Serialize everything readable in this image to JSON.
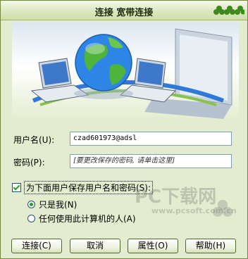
{
  "window": {
    "title": "连接 宽带连接"
  },
  "form": {
    "username_label": "用户名(U):",
    "username_value": "czad601973@adsl",
    "password_label": "密码(P):",
    "password_placeholder": "[要更改保存的密码, 请单击这里]",
    "save_checkbox_label": "为下面用户保存用户名和密码(S):",
    "save_checked": true,
    "radio_me_label": "只是我(N)",
    "radio_anyone_label": "任何使用此计算机的人(A)",
    "selected_radio": "me"
  },
  "buttons": {
    "connect": "连接(C)",
    "cancel": "取消",
    "properties": "属性(O)",
    "help": "帮助(H)"
  },
  "watermark": {
    "brand_cn": "下载网",
    "brand_en": "PC",
    "url": "www.pcsoft.com.cn"
  },
  "icons": [
    "clover-icon",
    "globe-icon",
    "laptop-icon",
    "laptop-icon",
    "clover-watermark-icon"
  ]
}
